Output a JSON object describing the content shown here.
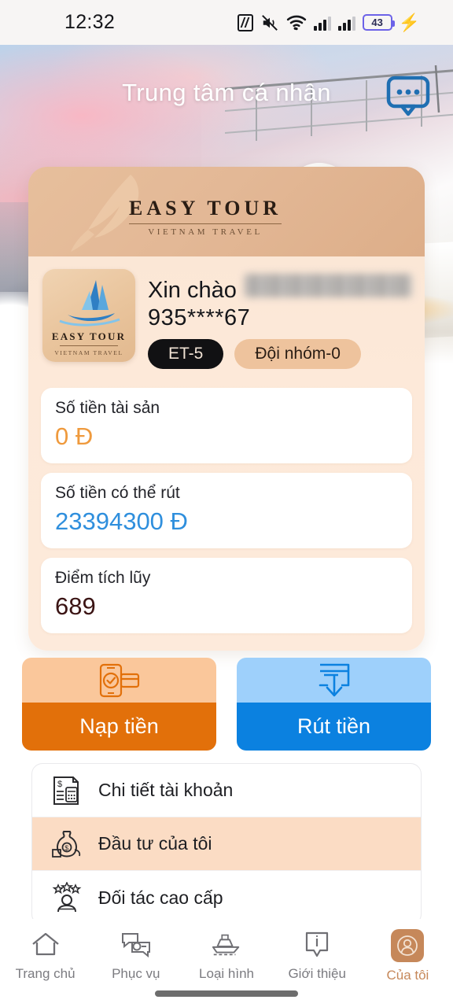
{
  "statusbar": {
    "time": "12:32",
    "battery_level": "43",
    "icons": [
      "nfc-icon",
      "mute-icon",
      "wifi-icon",
      "signal-icon",
      "signal-icon",
      "battery-icon",
      "charging-bolt-icon"
    ]
  },
  "header": {
    "title": "Trung tâm cá nhân",
    "chat_icon": "chat-bubble-icon"
  },
  "brand": {
    "name": "EASY TOUR",
    "tagline": "VIETNAM TRAVEL"
  },
  "profile": {
    "avatar_brand": "EASY TOUR",
    "avatar_tagline": "VIETNAM TRAVEL",
    "greeting": "Xin chào",
    "name_redacted": "",
    "phone": "935****67",
    "level_badge": "ET-5",
    "team_badge": "Đội nhóm-0"
  },
  "stats": [
    {
      "label": "Số tiền tài sản",
      "value": "0 Đ",
      "color": "#ef9a3d"
    },
    {
      "label": "Số tiền có thể rút",
      "value": "23394300 Đ",
      "color": "#2f8fdd"
    },
    {
      "label": "Điểm tích lũy",
      "value": "689",
      "color": "#3b1414"
    }
  ],
  "actions": [
    {
      "label": "Nạp tiền",
      "icon": "phone-card-deposit-icon",
      "color": "#e2700a"
    },
    {
      "label": "Rút tiền",
      "icon": "box-down-arrow-withdraw-icon",
      "color": "#0b81e0"
    }
  ],
  "menu": [
    {
      "label": "Chi tiết tài khoản",
      "icon": "invoice-calculator-icon",
      "active": false
    },
    {
      "label": "Đầu tư của tôi",
      "icon": "money-bag-icon",
      "active": true
    },
    {
      "label": "Đối tác cao cấp",
      "icon": "person-stars-icon",
      "active": false
    }
  ],
  "bottomnav": [
    {
      "label": "Trang chủ",
      "icon": "home-icon",
      "active": false
    },
    {
      "label": "Phục vụ",
      "icon": "support-chat-icon",
      "active": false
    },
    {
      "label": "Loại hình",
      "icon": "ship-icon",
      "active": false
    },
    {
      "label": "Giới thiệu",
      "icon": "info-icon",
      "active": false
    },
    {
      "label": "Của tôi",
      "icon": "user-avatar-icon",
      "active": true
    }
  ],
  "colors": {
    "accent_tan": "#c6885a",
    "deposit_orange": "#e2700a",
    "withdraw_blue": "#0b81e0",
    "card_tan": "#e3b896",
    "card_body": "#fdeadb",
    "highlight_row": "#fbdcc4"
  }
}
